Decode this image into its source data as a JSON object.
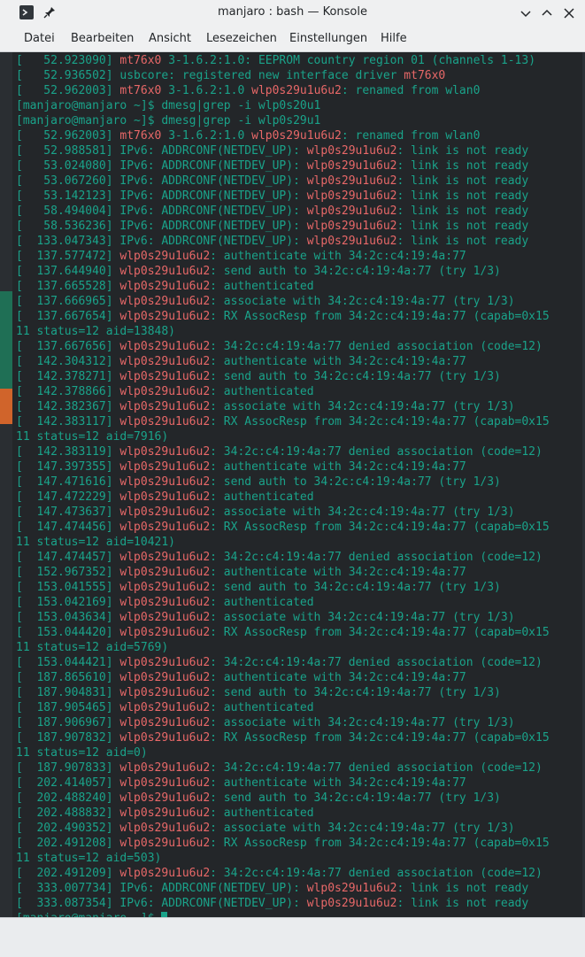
{
  "window": {
    "title": "manjaro : bash — Konsole"
  },
  "menu": [
    "Datei",
    "Bearbeiten",
    "Ansicht",
    "Lesezeichen",
    "Einstellungen",
    "Hilfe"
  ],
  "terminal": {
    "lines": [
      "[   52.923090] mt76x0 3-1.6.2:1.0: EEPROM country region 01 (channels 1-13)",
      "[   52.936502] usbcore: registered new interface driver mt76x0",
      "[   52.962003] mt76x0 3-1.6.2:1.0 wlp0s29u1u6u2: renamed from wlan0",
      "[manjaro@manjaro ~]$ dmesg|grep -i wlp0s20u1",
      "[manjaro@manjaro ~]$ dmesg|grep -i wlp0s29u1",
      "[   52.962003] mt76x0 3-1.6.2:1.0 wlp0s29u1u6u2: renamed from wlan0",
      "[   52.988581] IPv6: ADDRCONF(NETDEV_UP): wlp0s29u1u6u2: link is not ready",
      "[   53.024080] IPv6: ADDRCONF(NETDEV_UP): wlp0s29u1u6u2: link is not ready",
      "[   53.067260] IPv6: ADDRCONF(NETDEV_UP): wlp0s29u1u6u2: link is not ready",
      "[   53.142123] IPv6: ADDRCONF(NETDEV_UP): wlp0s29u1u6u2: link is not ready",
      "[   58.494004] IPv6: ADDRCONF(NETDEV_UP): wlp0s29u1u6u2: link is not ready",
      "[   58.536236] IPv6: ADDRCONF(NETDEV_UP): wlp0s29u1u6u2: link is not ready",
      "[  133.047343] IPv6: ADDRCONF(NETDEV_UP): wlp0s29u1u6u2: link is not ready",
      "[  137.577472] wlp0s29u1u6u2: authenticate with 34:2c:c4:19:4a:77",
      "[  137.644940] wlp0s29u1u6u2: send auth to 34:2c:c4:19:4a:77 (try 1/3)",
      "[  137.665528] wlp0s29u1u6u2: authenticated",
      "[  137.666965] wlp0s29u1u6u2: associate with 34:2c:c4:19:4a:77 (try 1/3)",
      "[  137.667654] wlp0s29u1u6u2: RX AssocResp from 34:2c:c4:19:4a:77 (capab=0x15",
      "11 status=12 aid=13848)",
      "[  137.667656] wlp0s29u1u6u2: 34:2c:c4:19:4a:77 denied association (code=12)",
      "[  142.304312] wlp0s29u1u6u2: authenticate with 34:2c:c4:19:4a:77",
      "[  142.378271] wlp0s29u1u6u2: send auth to 34:2c:c4:19:4a:77 (try 1/3)",
      "[  142.378866] wlp0s29u1u6u2: authenticated",
      "[  142.382367] wlp0s29u1u6u2: associate with 34:2c:c4:19:4a:77 (try 1/3)",
      "[  142.383117] wlp0s29u1u6u2: RX AssocResp from 34:2c:c4:19:4a:77 (capab=0x15",
      "11 status=12 aid=7916)",
      "[  142.383119] wlp0s29u1u6u2: 34:2c:c4:19:4a:77 denied association (code=12)",
      "[  147.397355] wlp0s29u1u6u2: authenticate with 34:2c:c4:19:4a:77",
      "[  147.471616] wlp0s29u1u6u2: send auth to 34:2c:c4:19:4a:77 (try 1/3)",
      "[  147.472229] wlp0s29u1u6u2: authenticated",
      "[  147.473637] wlp0s29u1u6u2: associate with 34:2c:c4:19:4a:77 (try 1/3)",
      "[  147.474456] wlp0s29u1u6u2: RX AssocResp from 34:2c:c4:19:4a:77 (capab=0x15",
      "11 status=12 aid=10421)",
      "[  147.474457] wlp0s29u1u6u2: 34:2c:c4:19:4a:77 denied association (code=12)",
      "[  152.967352] wlp0s29u1u6u2: authenticate with 34:2c:c4:19:4a:77",
      "[  153.041555] wlp0s29u1u6u2: send auth to 34:2c:c4:19:4a:77 (try 1/3)",
      "[  153.042169] wlp0s29u1u6u2: authenticated",
      "[  153.043634] wlp0s29u1u6u2: associate with 34:2c:c4:19:4a:77 (try 1/3)",
      "[  153.044420] wlp0s29u1u6u2: RX AssocResp from 34:2c:c4:19:4a:77 (capab=0x15",
      "11 status=12 aid=5769)",
      "[  153.044421] wlp0s29u1u6u2: 34:2c:c4:19:4a:77 denied association (code=12)",
      "[  187.865610] wlp0s29u1u6u2: authenticate with 34:2c:c4:19:4a:77",
      "[  187.904831] wlp0s29u1u6u2: send auth to 34:2c:c4:19:4a:77 (try 1/3)",
      "[  187.905465] wlp0s29u1u6u2: authenticated",
      "[  187.906967] wlp0s29u1u6u2: associate with 34:2c:c4:19:4a:77 (try 1/3)",
      "[  187.907832] wlp0s29u1u6u2: RX AssocResp from 34:2c:c4:19:4a:77 (capab=0x15",
      "11 status=12 aid=0)",
      "[  187.907833] wlp0s29u1u6u2: 34:2c:c4:19:4a:77 denied association (code=12)",
      "[  202.414057] wlp0s29u1u6u2: authenticate with 34:2c:c4:19:4a:77",
      "[  202.488240] wlp0s29u1u6u2: send auth to 34:2c:c4:19:4a:77 (try 1/3)",
      "[  202.488832] wlp0s29u1u6u2: authenticated",
      "[  202.490352] wlp0s29u1u6u2: associate with 34:2c:c4:19:4a:77 (try 1/3)",
      "[  202.491208] wlp0s29u1u6u2: RX AssocResp from 34:2c:c4:19:4a:77 (capab=0x15",
      "11 status=12 aid=503)",
      "[  202.491209] wlp0s29u1u6u2: 34:2c:c4:19:4a:77 denied association (code=12)",
      "[  333.007734] IPv6: ADDRCONF(NETDEV_UP): wlp0s29u1u6u2: link is not ready",
      "[  333.087354] IPv6: ADDRCONF(NETDEV_UP): wlp0s29u1u6u2: link is not ready",
      "[manjaro@manjaro ~]$ "
    ]
  },
  "colors": {
    "terminal_bg": "#232629",
    "text_green": "#1aa38a",
    "highlight_red": "#e86868"
  }
}
